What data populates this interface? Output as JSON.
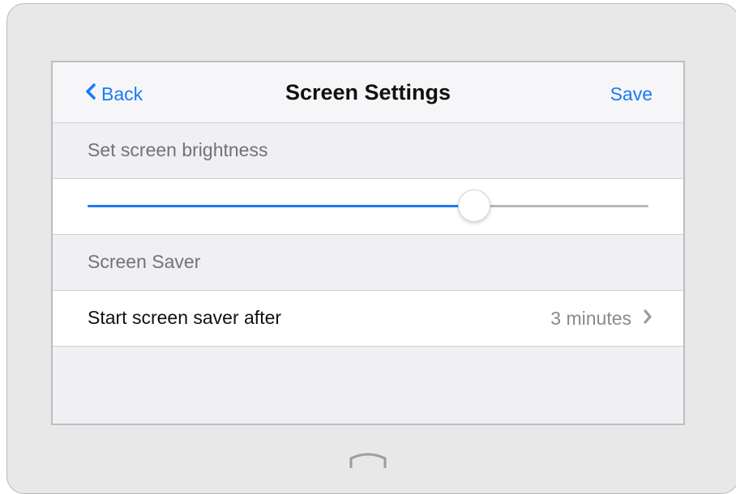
{
  "navbar": {
    "back_label": "Back",
    "title": "Screen Settings",
    "save_label": "Save"
  },
  "brightness": {
    "header": "Set screen brightness",
    "level": 0.69
  },
  "screen_saver": {
    "header": "Screen Saver",
    "row_label": "Start screen saver after",
    "row_value": "3 minutes"
  },
  "icons": {
    "back": "chevron-left-icon",
    "disclosure": "chevron-right-icon",
    "home": "home-button-icon"
  },
  "colors": {
    "accent": "#1a7bf5",
    "track": "#b8b8b8",
    "background": "#efeff4",
    "row": "#ffffff"
  }
}
